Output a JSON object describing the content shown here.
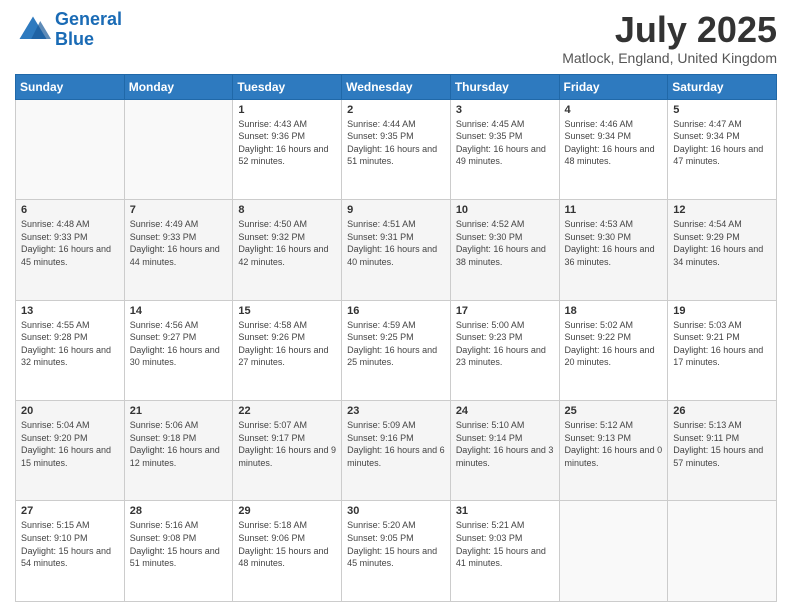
{
  "header": {
    "logo_line1": "General",
    "logo_line2": "Blue",
    "title": "July 2025",
    "subtitle": "Matlock, England, United Kingdom"
  },
  "days_of_week": [
    "Sunday",
    "Monday",
    "Tuesday",
    "Wednesday",
    "Thursday",
    "Friday",
    "Saturday"
  ],
  "weeks": [
    [
      {
        "day": "",
        "sunrise": "",
        "sunset": "",
        "daylight": ""
      },
      {
        "day": "",
        "sunrise": "",
        "sunset": "",
        "daylight": ""
      },
      {
        "day": "1",
        "sunrise": "Sunrise: 4:43 AM",
        "sunset": "Sunset: 9:36 PM",
        "daylight": "Daylight: 16 hours and 52 minutes."
      },
      {
        "day": "2",
        "sunrise": "Sunrise: 4:44 AM",
        "sunset": "Sunset: 9:35 PM",
        "daylight": "Daylight: 16 hours and 51 minutes."
      },
      {
        "day": "3",
        "sunrise": "Sunrise: 4:45 AM",
        "sunset": "Sunset: 9:35 PM",
        "daylight": "Daylight: 16 hours and 49 minutes."
      },
      {
        "day": "4",
        "sunrise": "Sunrise: 4:46 AM",
        "sunset": "Sunset: 9:34 PM",
        "daylight": "Daylight: 16 hours and 48 minutes."
      },
      {
        "day": "5",
        "sunrise": "Sunrise: 4:47 AM",
        "sunset": "Sunset: 9:34 PM",
        "daylight": "Daylight: 16 hours and 47 minutes."
      }
    ],
    [
      {
        "day": "6",
        "sunrise": "Sunrise: 4:48 AM",
        "sunset": "Sunset: 9:33 PM",
        "daylight": "Daylight: 16 hours and 45 minutes."
      },
      {
        "day": "7",
        "sunrise": "Sunrise: 4:49 AM",
        "sunset": "Sunset: 9:33 PM",
        "daylight": "Daylight: 16 hours and 44 minutes."
      },
      {
        "day": "8",
        "sunrise": "Sunrise: 4:50 AM",
        "sunset": "Sunset: 9:32 PM",
        "daylight": "Daylight: 16 hours and 42 minutes."
      },
      {
        "day": "9",
        "sunrise": "Sunrise: 4:51 AM",
        "sunset": "Sunset: 9:31 PM",
        "daylight": "Daylight: 16 hours and 40 minutes."
      },
      {
        "day": "10",
        "sunrise": "Sunrise: 4:52 AM",
        "sunset": "Sunset: 9:30 PM",
        "daylight": "Daylight: 16 hours and 38 minutes."
      },
      {
        "day": "11",
        "sunrise": "Sunrise: 4:53 AM",
        "sunset": "Sunset: 9:30 PM",
        "daylight": "Daylight: 16 hours and 36 minutes."
      },
      {
        "day": "12",
        "sunrise": "Sunrise: 4:54 AM",
        "sunset": "Sunset: 9:29 PM",
        "daylight": "Daylight: 16 hours and 34 minutes."
      }
    ],
    [
      {
        "day": "13",
        "sunrise": "Sunrise: 4:55 AM",
        "sunset": "Sunset: 9:28 PM",
        "daylight": "Daylight: 16 hours and 32 minutes."
      },
      {
        "day": "14",
        "sunrise": "Sunrise: 4:56 AM",
        "sunset": "Sunset: 9:27 PM",
        "daylight": "Daylight: 16 hours and 30 minutes."
      },
      {
        "day": "15",
        "sunrise": "Sunrise: 4:58 AM",
        "sunset": "Sunset: 9:26 PM",
        "daylight": "Daylight: 16 hours and 27 minutes."
      },
      {
        "day": "16",
        "sunrise": "Sunrise: 4:59 AM",
        "sunset": "Sunset: 9:25 PM",
        "daylight": "Daylight: 16 hours and 25 minutes."
      },
      {
        "day": "17",
        "sunrise": "Sunrise: 5:00 AM",
        "sunset": "Sunset: 9:23 PM",
        "daylight": "Daylight: 16 hours and 23 minutes."
      },
      {
        "day": "18",
        "sunrise": "Sunrise: 5:02 AM",
        "sunset": "Sunset: 9:22 PM",
        "daylight": "Daylight: 16 hours and 20 minutes."
      },
      {
        "day": "19",
        "sunrise": "Sunrise: 5:03 AM",
        "sunset": "Sunset: 9:21 PM",
        "daylight": "Daylight: 16 hours and 17 minutes."
      }
    ],
    [
      {
        "day": "20",
        "sunrise": "Sunrise: 5:04 AM",
        "sunset": "Sunset: 9:20 PM",
        "daylight": "Daylight: 16 hours and 15 minutes."
      },
      {
        "day": "21",
        "sunrise": "Sunrise: 5:06 AM",
        "sunset": "Sunset: 9:18 PM",
        "daylight": "Daylight: 16 hours and 12 minutes."
      },
      {
        "day": "22",
        "sunrise": "Sunrise: 5:07 AM",
        "sunset": "Sunset: 9:17 PM",
        "daylight": "Daylight: 16 hours and 9 minutes."
      },
      {
        "day": "23",
        "sunrise": "Sunrise: 5:09 AM",
        "sunset": "Sunset: 9:16 PM",
        "daylight": "Daylight: 16 hours and 6 minutes."
      },
      {
        "day": "24",
        "sunrise": "Sunrise: 5:10 AM",
        "sunset": "Sunset: 9:14 PM",
        "daylight": "Daylight: 16 hours and 3 minutes."
      },
      {
        "day": "25",
        "sunrise": "Sunrise: 5:12 AM",
        "sunset": "Sunset: 9:13 PM",
        "daylight": "Daylight: 16 hours and 0 minutes."
      },
      {
        "day": "26",
        "sunrise": "Sunrise: 5:13 AM",
        "sunset": "Sunset: 9:11 PM",
        "daylight": "Daylight: 15 hours and 57 minutes."
      }
    ],
    [
      {
        "day": "27",
        "sunrise": "Sunrise: 5:15 AM",
        "sunset": "Sunset: 9:10 PM",
        "daylight": "Daylight: 15 hours and 54 minutes."
      },
      {
        "day": "28",
        "sunrise": "Sunrise: 5:16 AM",
        "sunset": "Sunset: 9:08 PM",
        "daylight": "Daylight: 15 hours and 51 minutes."
      },
      {
        "day": "29",
        "sunrise": "Sunrise: 5:18 AM",
        "sunset": "Sunset: 9:06 PM",
        "daylight": "Daylight: 15 hours and 48 minutes."
      },
      {
        "day": "30",
        "sunrise": "Sunrise: 5:20 AM",
        "sunset": "Sunset: 9:05 PM",
        "daylight": "Daylight: 15 hours and 45 minutes."
      },
      {
        "day": "31",
        "sunrise": "Sunrise: 5:21 AM",
        "sunset": "Sunset: 9:03 PM",
        "daylight": "Daylight: 15 hours and 41 minutes."
      },
      {
        "day": "",
        "sunrise": "",
        "sunset": "",
        "daylight": ""
      },
      {
        "day": "",
        "sunrise": "",
        "sunset": "",
        "daylight": ""
      }
    ]
  ]
}
